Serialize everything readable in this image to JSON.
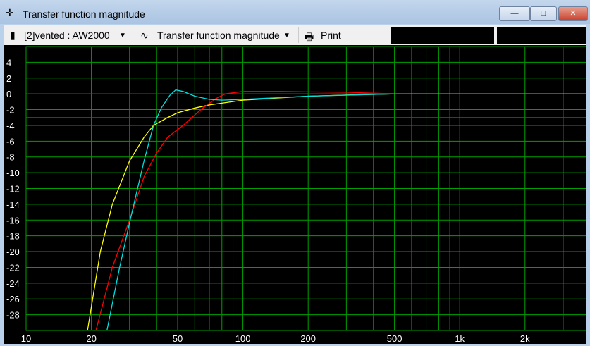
{
  "window": {
    "title": "Transfer function magnitude",
    "icon": "crosshair-icon",
    "minimize": "—",
    "maximize": "□",
    "close": "✕"
  },
  "toolbar": {
    "project": "[2]vented : AW2000",
    "view": "Transfer function magnitude",
    "print": "Print"
  },
  "chart_data": {
    "type": "line",
    "xscale": "log",
    "xlim": [
      10,
      3900
    ],
    "ylim": [
      -30,
      6
    ],
    "x_ticks": [
      10,
      20,
      50,
      100,
      200,
      500,
      1000,
      2000
    ],
    "x_tick_labels": [
      "10",
      "20",
      "50",
      "100",
      "200",
      "500",
      "1k",
      "2k"
    ],
    "y_ticks": [
      4,
      2,
      0,
      -2,
      -4,
      -6,
      -8,
      -10,
      -12,
      -14,
      -16,
      -18,
      -20,
      -22,
      -24,
      -26,
      -28
    ],
    "grid": true,
    "reference_lines": [
      {
        "name": "0 dB",
        "y": 0,
        "color": "#ff0000"
      },
      {
        "name": "-3 dB",
        "y": -3,
        "color": "#c000c0"
      }
    ],
    "series": [
      {
        "name": "yellow",
        "color": "#ffff00",
        "x": [
          19.2,
          22,
          25,
          30,
          35,
          38.7,
          45,
          50,
          60,
          70,
          100,
          150,
          200,
          300,
          500,
          3900
        ],
        "y": [
          -30,
          -20,
          -14,
          -8.5,
          -5.5,
          -4,
          -3,
          -2.4,
          -1.8,
          -1.4,
          -0.8,
          -0.5,
          -0.3,
          -0.15,
          0,
          0
        ]
      },
      {
        "name": "red",
        "color": "#ff0000",
        "x": [
          21,
          25,
          30,
          35,
          40,
          45,
          53,
          64,
          75,
          83,
          100,
          150,
          200,
          300,
          500,
          3900
        ],
        "y": [
          -30,
          -22,
          -16,
          -10.5,
          -7.5,
          -5.5,
          -4,
          -2,
          -0.6,
          0,
          0.3,
          0.3,
          0.25,
          0.2,
          0,
          0
        ]
      },
      {
        "name": "cyan",
        "color": "#00e0e0",
        "x": [
          23.6,
          27,
          30.2,
          35,
          38.7,
          42,
          46,
          49,
          53,
          60,
          70,
          80,
          100,
          200,
          500,
          3900
        ],
        "y": [
          -30,
          -22,
          -16,
          -8.5,
          -4,
          -1.8,
          -0.2,
          0.5,
          0.3,
          -0.3,
          -0.7,
          -0.8,
          -0.7,
          -0.3,
          0,
          0
        ]
      }
    ]
  }
}
